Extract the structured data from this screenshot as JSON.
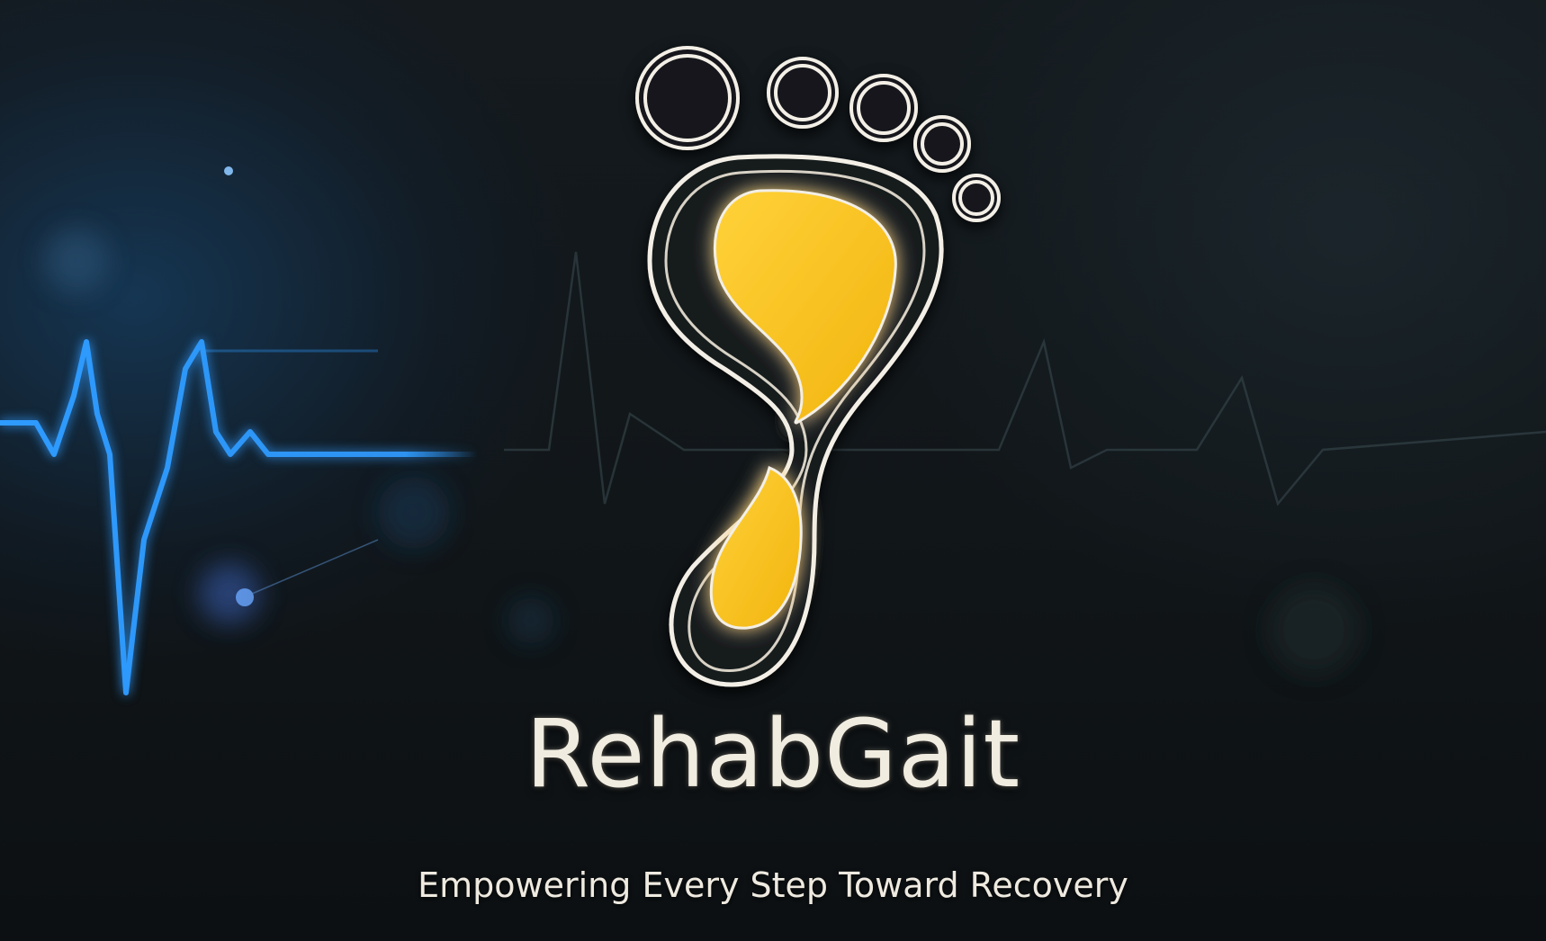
{
  "brand": {
    "name": "RehabGait",
    "tagline": "Empowering Every Step Toward Recovery"
  },
  "colors": {
    "background": "#111619",
    "accent_yellow": "#f6c21c",
    "outline_white": "#f3efe6",
    "pulse_blue": "#2f9bff",
    "text": "#f1ece0"
  },
  "icons": {
    "logo": "footprint-logo",
    "background_graphic": "heartbeat-pulse-line"
  }
}
